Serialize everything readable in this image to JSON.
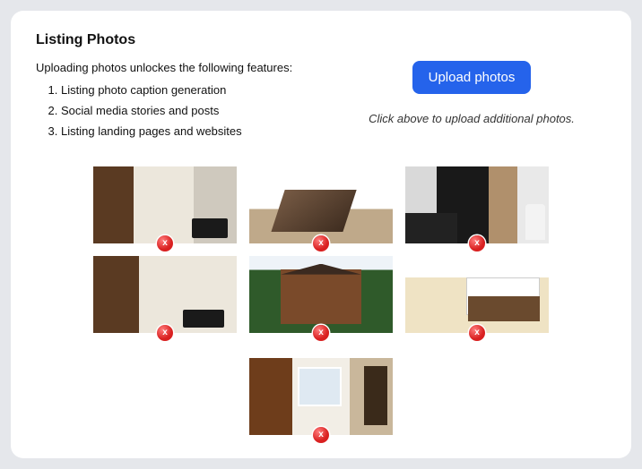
{
  "title": "Listing Photos",
  "intro": "Uploading photos unlockes the following features:",
  "features": [
    "Listing photo caption generation",
    "Social media stories and posts",
    "Listing landing pages and websites"
  ],
  "upload_button_label": "Upload photos",
  "helper_text": "Click above to upload additional photos.",
  "photos": [
    {
      "name": "interior-room-1"
    },
    {
      "name": "staircase"
    },
    {
      "name": "hallway"
    },
    {
      "name": "interior-room-2"
    },
    {
      "name": "house-exterior"
    },
    {
      "name": "bathroom-sink"
    },
    {
      "name": "living-room"
    }
  ],
  "delete_icon_label": "x"
}
